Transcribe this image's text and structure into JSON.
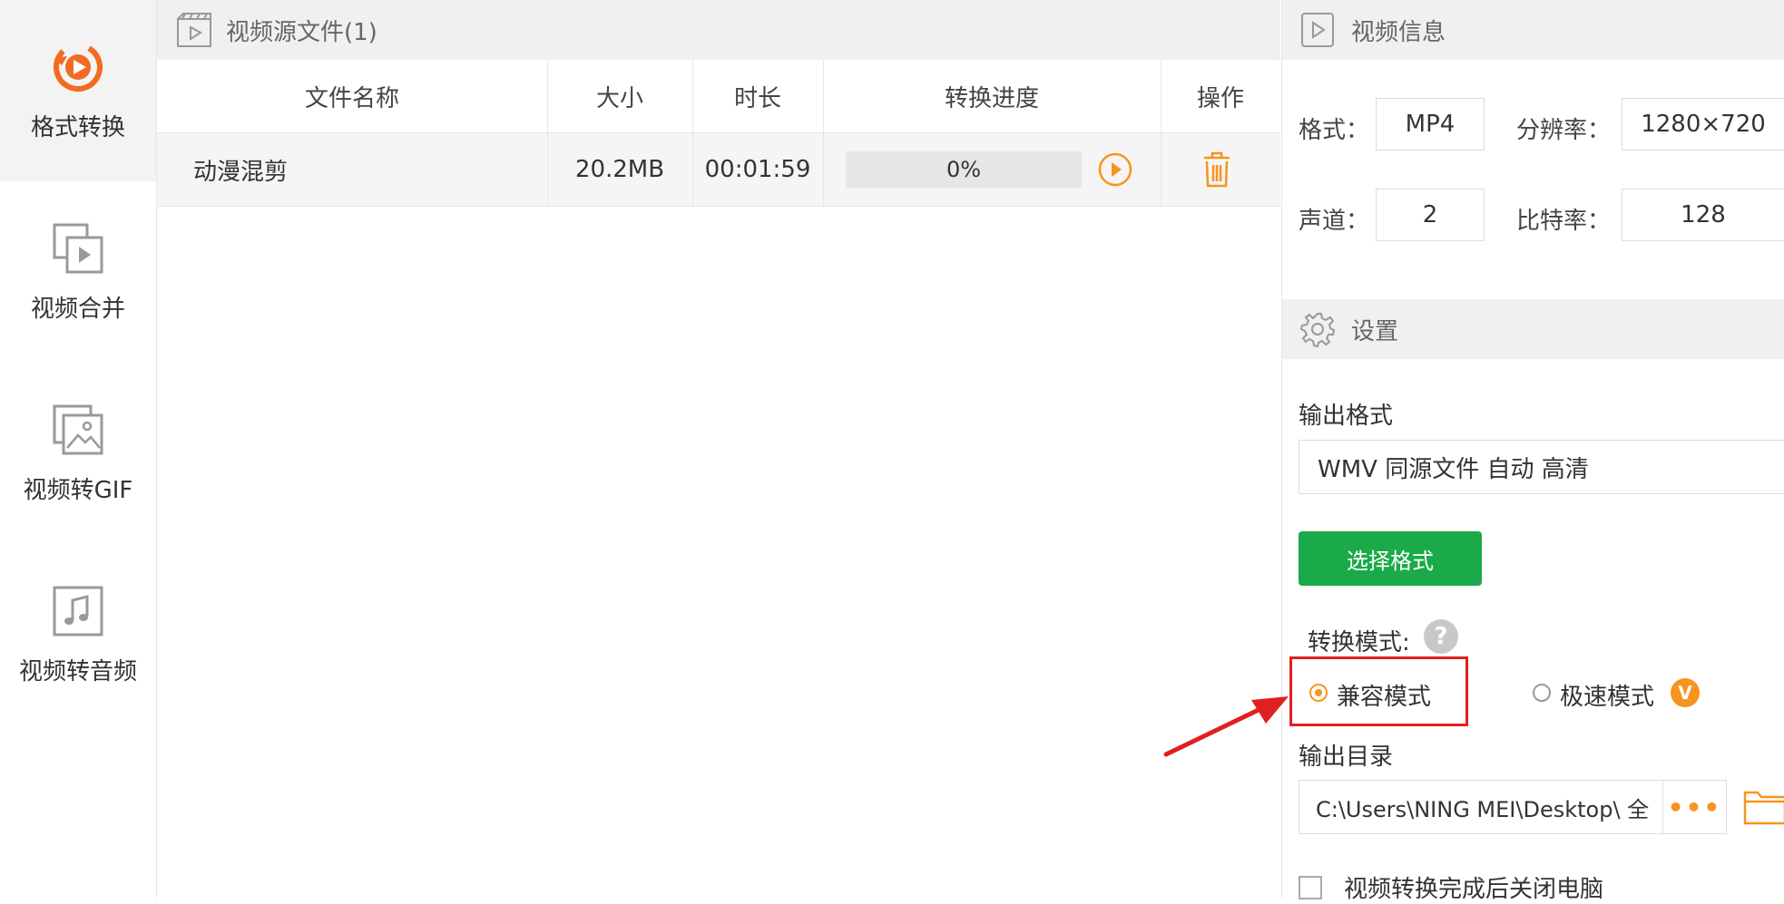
{
  "colors": {
    "accent": "#f7941d",
    "green_button": "#1aaa4a",
    "highlight_red": "#e02020",
    "header_bg": "#f0f0f0"
  },
  "sidebar": {
    "items": [
      {
        "label": "格式转换",
        "icon": "format-convert-icon",
        "active": true
      },
      {
        "label": "视频合并",
        "icon": "video-merge-icon",
        "active": false
      },
      {
        "label": "视频转GIF",
        "icon": "image-gif-icon",
        "active": false
      },
      {
        "label": "视频转音频",
        "icon": "music-note-icon",
        "active": false
      }
    ]
  },
  "source_panel": {
    "title": "视频源文件(1)",
    "columns": [
      "文件名称",
      "大小",
      "时长",
      "转换进度",
      "操作"
    ],
    "rows": [
      {
        "name": "动漫混剪",
        "size": "20.2MB",
        "duration": "00:01:59",
        "progress_text": "0%",
        "progress": 0
      }
    ]
  },
  "video_info": {
    "title": "视频信息",
    "format_label": "格式：",
    "format_value": "MP4",
    "resolution_label": "分辨率：",
    "resolution_value": "1280×720",
    "channel_label": "声道：",
    "channel_value": "2",
    "bitrate_label": "比特率：",
    "bitrate_value": "128"
  },
  "settings": {
    "title": "设置",
    "output_format_label": "输出格式",
    "output_format_value": "WMV 同源文件 自动 高清",
    "choose_format_button": "选择格式",
    "convert_mode_label": "转换模式:",
    "help_glyph": "?",
    "mode_compatible": "兼容模式",
    "mode_fast": "极速模式",
    "vip_glyph": "V",
    "selected_mode": "兼容模式",
    "output_dir_label": "输出目录",
    "output_dir_value": "C:\\Users\\NING MEI\\Desktop\\ 全",
    "browse_button": "•••",
    "shutdown_checkbox_label": "视频转换完成后关闭电脑",
    "shutdown_checked": false
  }
}
